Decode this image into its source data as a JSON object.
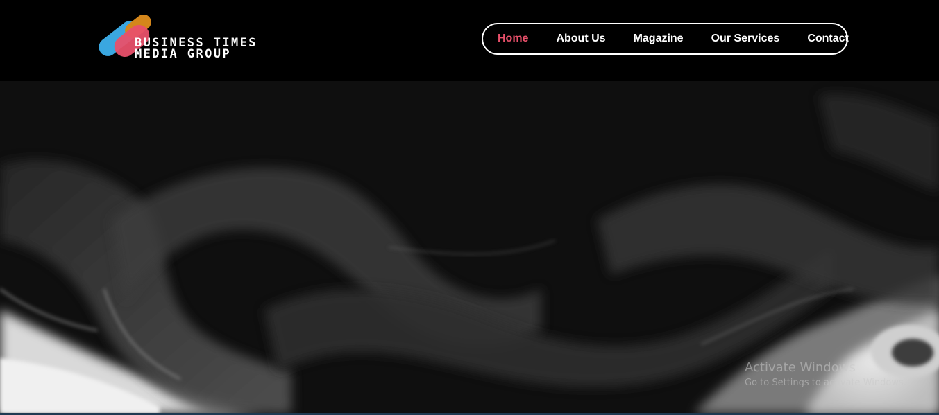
{
  "brand": {
    "line1": "BUSINESS TIMES",
    "line2": "MEDIA GROUP",
    "colors": {
      "blue": "#3aa7e0",
      "pink": "#e8506a",
      "orange": "#d4861b"
    }
  },
  "nav": {
    "items": [
      {
        "label": "Home",
        "active": true
      },
      {
        "label": "About Us",
        "active": false
      },
      {
        "label": "Magazine",
        "active": false
      },
      {
        "label": "Our Services",
        "active": false
      },
      {
        "label": "Contact",
        "active": false
      }
    ],
    "active_color": "#e8506a"
  },
  "hero": {
    "background": "black-and-white smoke artwork"
  },
  "os_watermark": {
    "title": "Activate Windows",
    "subtitle": "Go to Settings to activate Windows."
  }
}
